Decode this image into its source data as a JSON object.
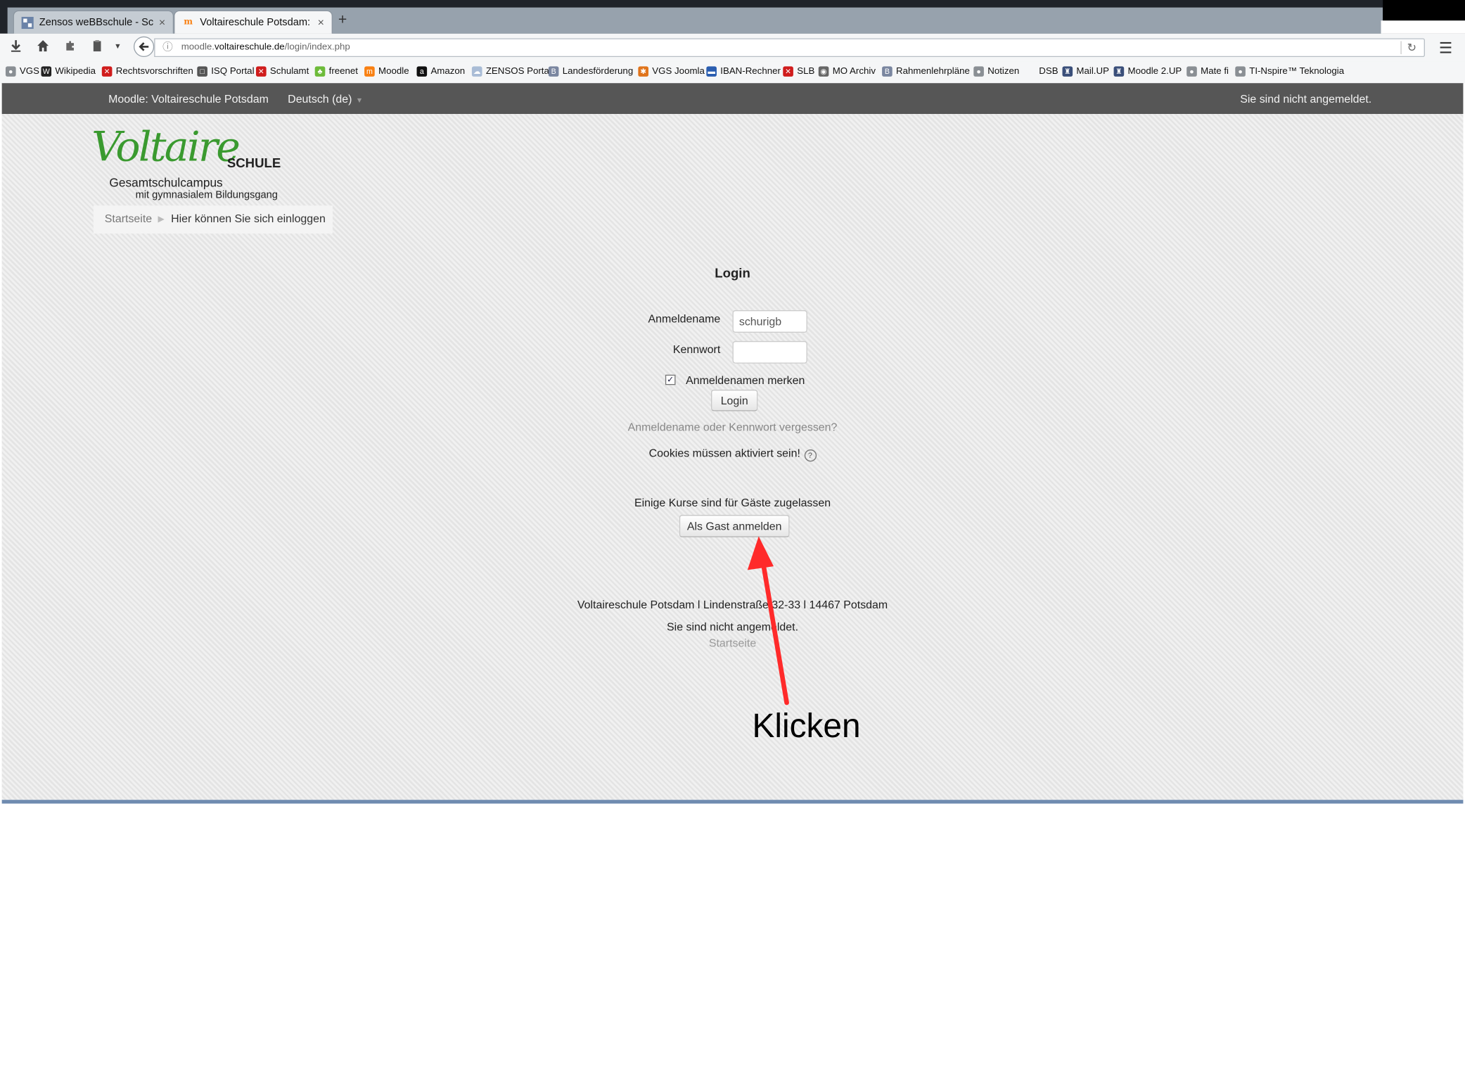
{
  "browser": {
    "tabs": [
      {
        "title": "Zensos weBBschule - Schül...",
        "close": "×"
      },
      {
        "title": "Voltaireschule Potsdam: Hi...",
        "close": "×"
      }
    ],
    "new_tab": "+",
    "url_prefix": "moodle.",
    "url_domain": "voltaireschule.de",
    "url_path": "/login/index.php",
    "bookmarks": [
      {
        "label": "VGS",
        "icon": "globe-icon",
        "color": "#8a8f94"
      },
      {
        "label": "Wikipedia",
        "icon": "wikipedia-icon",
        "color": "#222222"
      },
      {
        "label": "Rechtsvorschriften",
        "icon": "red-square-icon",
        "color": "#d01c1c"
      },
      {
        "label": "ISQ Portal",
        "icon": "speech-bubble-icon",
        "color": "#555555"
      },
      {
        "label": "Schulamt",
        "icon": "red-square-icon",
        "color": "#d01c1c"
      },
      {
        "label": "freenet",
        "icon": "leaf-icon",
        "color": "#6dbb3a"
      },
      {
        "label": "Moodle",
        "icon": "moodle-icon",
        "color": "#f98012"
      },
      {
        "label": "Amazon",
        "icon": "amazon-icon",
        "color": "#111111"
      },
      {
        "label": "ZENSOS Portal",
        "icon": "cloud-icon",
        "color": "#a9bcd6"
      },
      {
        "label": "Landesförderung",
        "icon": "bbb-icon",
        "color": "#7a86a0"
      },
      {
        "label": "VGS Joomla",
        "icon": "joomla-icon",
        "color": "#e0741b"
      },
      {
        "label": "IBAN-Rechner",
        "icon": "bank-icon",
        "color": "#2a5db0"
      },
      {
        "label": "SLB",
        "icon": "red-square-icon",
        "color": "#d01c1c"
      },
      {
        "label": "MO Archiv",
        "icon": "owl-icon",
        "color": "#666666"
      },
      {
        "label": "Rahmenlehrpläne",
        "icon": "bbb-icon",
        "color": "#7a86a0"
      },
      {
        "label": "Notizen",
        "icon": "globe-icon",
        "color": "#8a8f94"
      },
      {
        "label": "DSB",
        "icon": "none",
        "color": "#f5f6f7"
      },
      {
        "label": "Mail.UP",
        "icon": "castle-icon",
        "color": "#3a4f7a"
      },
      {
        "label": "Moodle 2.UP",
        "icon": "castle-icon",
        "color": "#3a4f7a"
      },
      {
        "label": "Mate fi",
        "icon": "globe-icon",
        "color": "#8a8f94"
      },
      {
        "label": "TI-Nspire™ Teknologia",
        "icon": "globe-icon",
        "color": "#8a8f94"
      }
    ]
  },
  "moodle": {
    "site_name": "Moodle: Voltaireschule Potsdam",
    "language": "Deutsch (de)",
    "login_state": "Sie sind nicht angemeldet.",
    "logo": {
      "wordmark": "Voltaire",
      "suffix": "SCHULE",
      "line1": "Gesamtschulcampus",
      "line2": "mit gymnasialem Bildungsgang"
    },
    "breadcrumb": {
      "home": "Startseite",
      "separator": "▶",
      "current": "Hier können Sie sich einloggen"
    },
    "login": {
      "heading": "Login",
      "username_label": "Anmeldename",
      "username_value": "schurigb",
      "password_label": "Kennwort",
      "password_value": "",
      "remember_label": "Anmeldenamen merken",
      "remember_checked": true,
      "submit_label": "Login",
      "forgot_link": "Anmeldename oder Kennwort vergessen?",
      "cookies_note": "Cookies müssen aktiviert sein!",
      "help_glyph": "?"
    },
    "guest": {
      "note": "Einige Kurse sind für Gäste zugelassen",
      "button_label": "Als Gast anmelden"
    },
    "footer": {
      "address": "Voltaireschule Potsdam l Lindenstraße 32-33 l 14467 Potsdam",
      "login_state": "Sie sind nicht angemeldet.",
      "home_link": "Startseite"
    }
  },
  "annotation": {
    "text": "Klicken",
    "arrow_color": "#ff2a2a"
  }
}
